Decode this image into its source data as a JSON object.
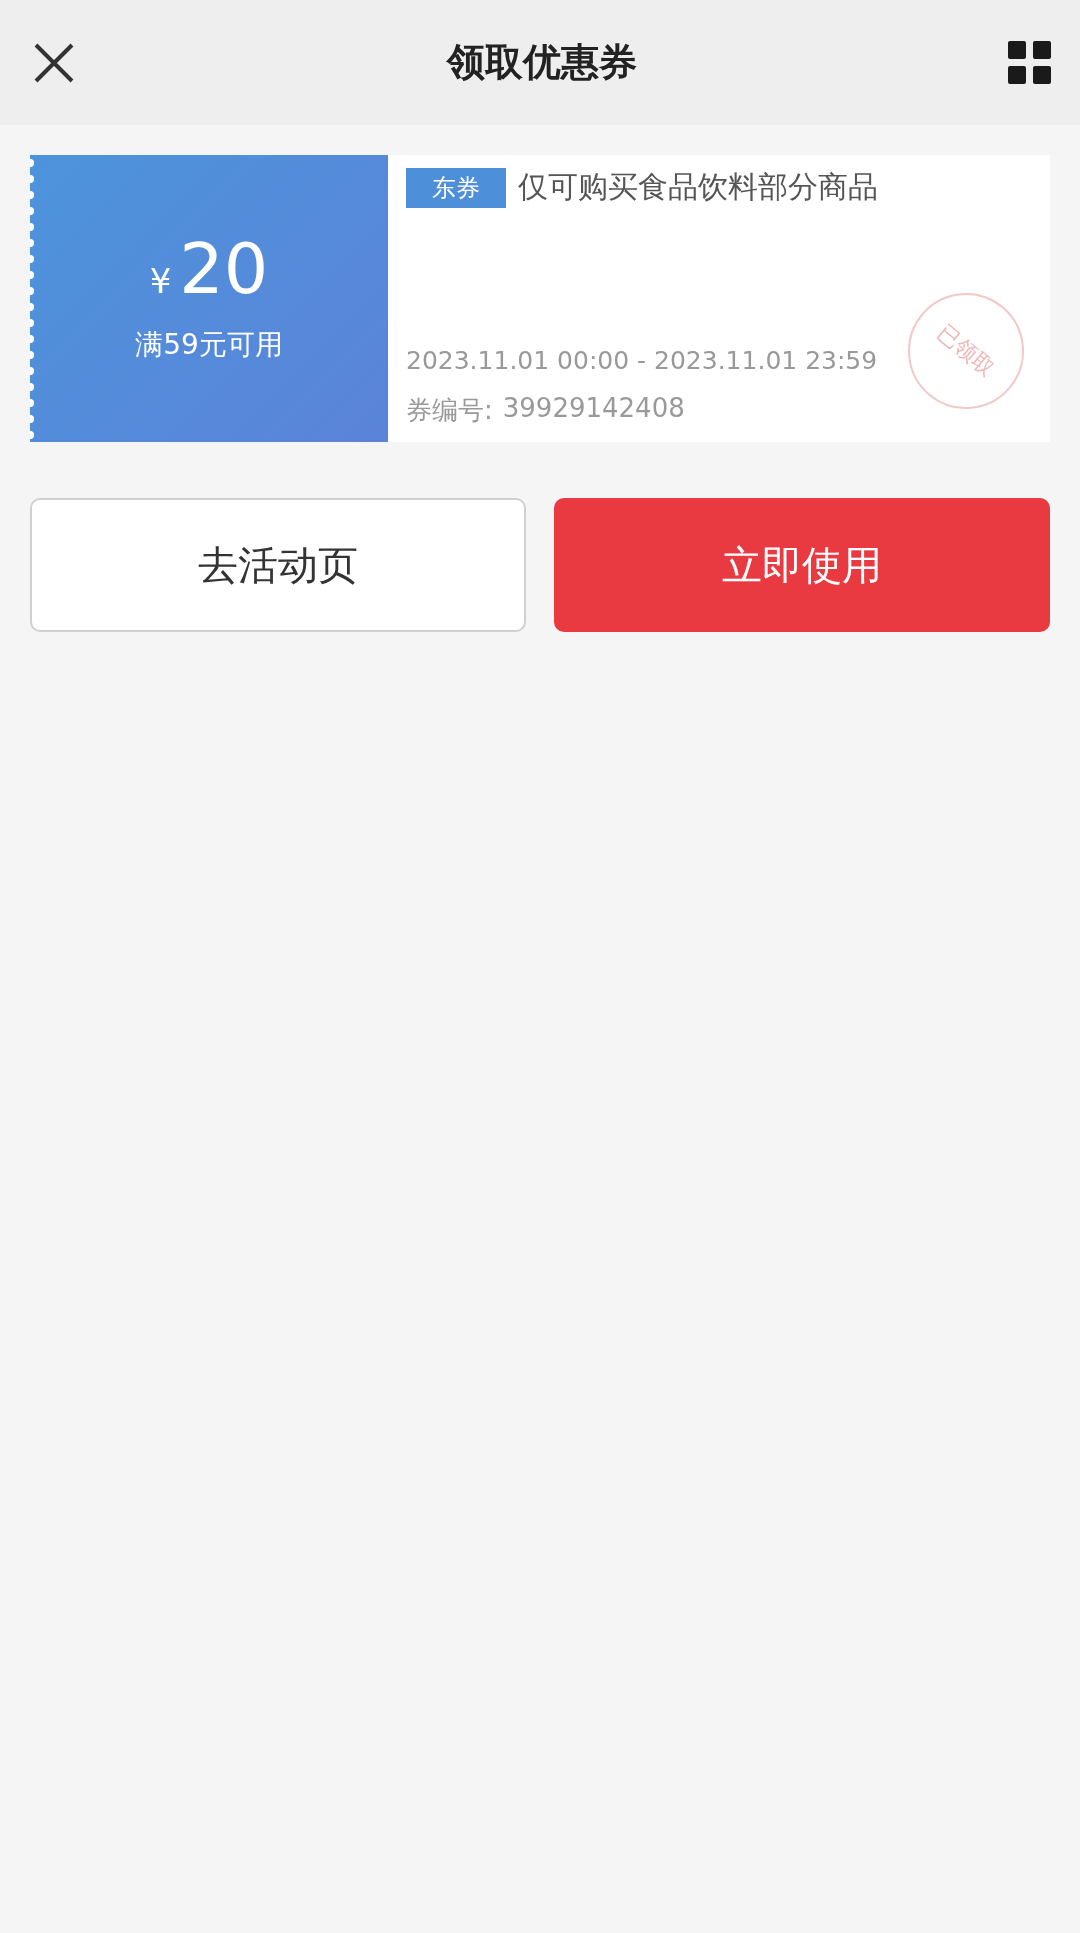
{
  "header": {
    "title": "领取优惠券"
  },
  "coupon": {
    "currency": "¥",
    "amount": "20",
    "condition": "满59元可用",
    "tag": "东券",
    "description": "仅可购买食品饮料部分商品",
    "validity": "2023.11.01 00:00 - 2023.11.01 23:59",
    "code_label": "券编号:",
    "code": "39929142408",
    "stamp": "已领取"
  },
  "buttons": [
    {
      "label": "去活动页",
      "kind": "secondary"
    },
    {
      "label": "立即使用",
      "kind": "primary"
    }
  ]
}
